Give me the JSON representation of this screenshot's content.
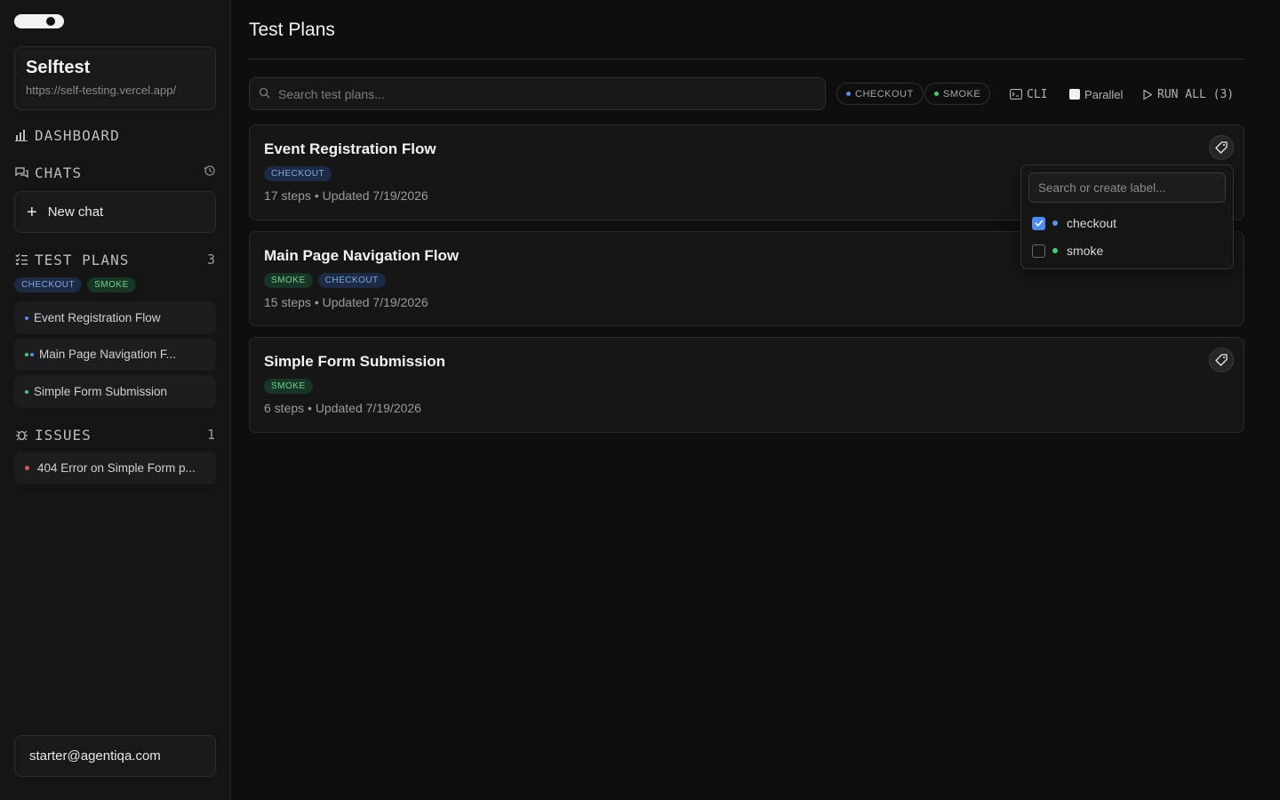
{
  "sidebar": {
    "project": {
      "name": "Selftest",
      "url": "https://self-testing.vercel.app/"
    },
    "nav": {
      "dashboard": "DASHBOARD",
      "chats": "CHATS",
      "new_chat": "New chat",
      "test_plans": "TEST PLANS",
      "test_plans_count": "3",
      "issues": "ISSUES",
      "issues_count": "1"
    },
    "tags": [
      "CHECKOUT",
      "SMOKE"
    ],
    "plans": [
      "Event Registration Flow",
      "Main Page Navigation F...",
      "Simple Form Submission"
    ],
    "issues": [
      "404 Error on Simple Form p..."
    ],
    "user": "starter@agentiqa.com"
  },
  "main": {
    "title": "Test Plans",
    "search_placeholder": "Search test plans...",
    "filters": {
      "checkout": "CHECKOUT",
      "smoke": "SMOKE"
    },
    "cli": "CLI",
    "parallel": "Parallel",
    "run_all": "RUN ALL (3)",
    "cards": [
      {
        "title": "Event Registration Flow",
        "tags": [
          "CHECKOUT"
        ],
        "meta": "17 steps • Updated 7/19/2026"
      },
      {
        "title": "Main Page Navigation Flow",
        "tags": [
          "SMOKE",
          "CHECKOUT"
        ],
        "meta": "15 steps • Updated 7/19/2026"
      },
      {
        "title": "Simple Form Submission",
        "tags": [
          "SMOKE"
        ],
        "meta": "6 steps • Updated 7/19/2026"
      }
    ]
  },
  "label_popover": {
    "placeholder": "Search or create label...",
    "options": [
      {
        "label": "checkout",
        "checked": true
      },
      {
        "label": "smoke",
        "checked": false
      }
    ]
  },
  "colors": {
    "checkout": "#5b8fe8",
    "smoke": "#3ecf72",
    "issue": "#e05454",
    "checkbox": "#4d8cf0"
  }
}
